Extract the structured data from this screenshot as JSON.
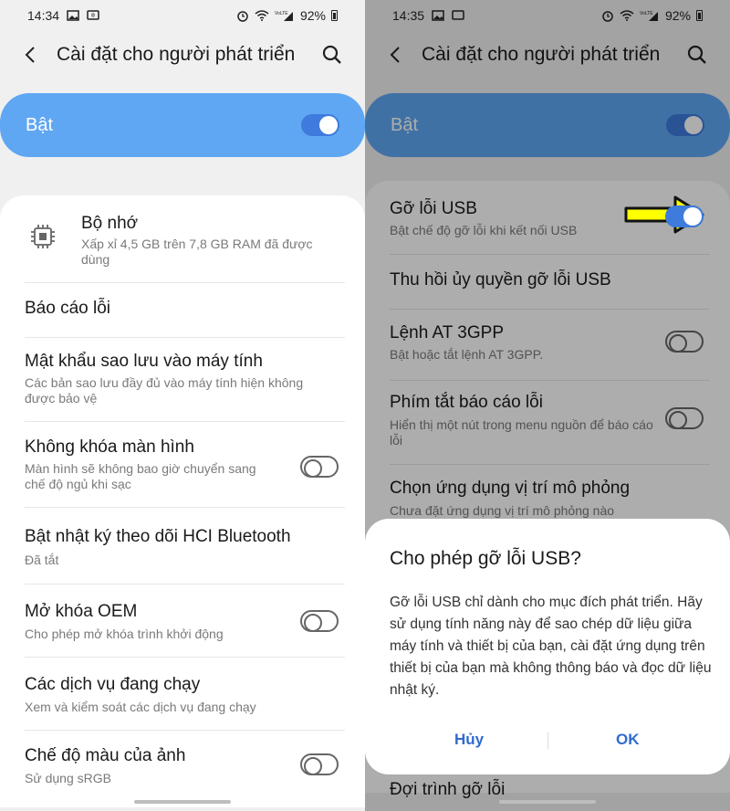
{
  "left": {
    "status": {
      "time": "14:34",
      "battery": "92%"
    },
    "appbar": {
      "title": "Cài đặt cho người phát triển"
    },
    "master": {
      "label": "Bật",
      "on": true
    },
    "items": [
      {
        "title": "Bộ nhớ",
        "subtitle": "Xấp xỉ 4,5 GB trên 7,8 GB RAM đã được dùng"
      },
      {
        "title": "Báo cáo lỗi",
        "subtitle": ""
      },
      {
        "title": "Mật khẩu sao lưu vào máy tính",
        "subtitle": "Các bản sao lưu đầy đủ vào máy tính hiện không được bảo vệ"
      },
      {
        "title": "Không khóa màn hình",
        "subtitle": "Màn hình sẽ không bao giờ chuyển sang chế độ ngủ khi sạc"
      },
      {
        "title": "Bật nhật ký theo dõi HCI Bluetooth",
        "subtitle": "Đã tắt"
      },
      {
        "title": "Mở khóa OEM",
        "subtitle": "Cho phép mở khóa trình khởi động"
      },
      {
        "title": "Các dịch vụ đang chạy",
        "subtitle": "Xem và kiểm soát các dịch vụ đang chạy"
      },
      {
        "title": "Chế độ màu của ảnh",
        "subtitle": "Sử dụng sRGB"
      }
    ]
  },
  "right": {
    "status": {
      "time": "14:35",
      "battery": "92%"
    },
    "appbar": {
      "title": "Cài đặt cho người phát triển"
    },
    "master": {
      "label": "Bật",
      "on": true
    },
    "items": [
      {
        "title": "Gỡ lỗi USB",
        "subtitle": "Bật chế độ gỡ lỗi khi kết nối USB"
      },
      {
        "title": "Thu hồi ủy quyền gỡ lỗi USB",
        "subtitle": ""
      },
      {
        "title": "Lệnh AT 3GPP",
        "subtitle": "Bật hoặc tắt lệnh AT 3GPP."
      },
      {
        "title": "Phím tắt báo cáo lỗi",
        "subtitle": "Hiển thị một nút trong menu nguồn để báo cáo lỗi"
      },
      {
        "title": "Chọn ứng dụng vị trí mô phỏng",
        "subtitle": "Chưa đặt ứng dụng vị trí mô phỏng nào"
      },
      {
        "title": "Đợi trình gỡ lỗi",
        "subtitle": ""
      }
    ],
    "dialog": {
      "title": "Cho phép gỡ lỗi USB?",
      "body": "Gỡ lỗi USB chỉ dành cho mục đích phát triển. Hãy sử dụng tính năng này để sao chép dữ liệu giữa máy tính và thiết bị của bạn, cài đặt ứng dụng trên thiết bị của bạn mà không thông báo và đọc dữ liệu nhật ký.",
      "cancel": "Hủy",
      "ok": "OK"
    }
  },
  "colors": {
    "accent": "#3e7bdc",
    "master_bg": "#5fa7f2",
    "arrow": "#ffff00"
  }
}
